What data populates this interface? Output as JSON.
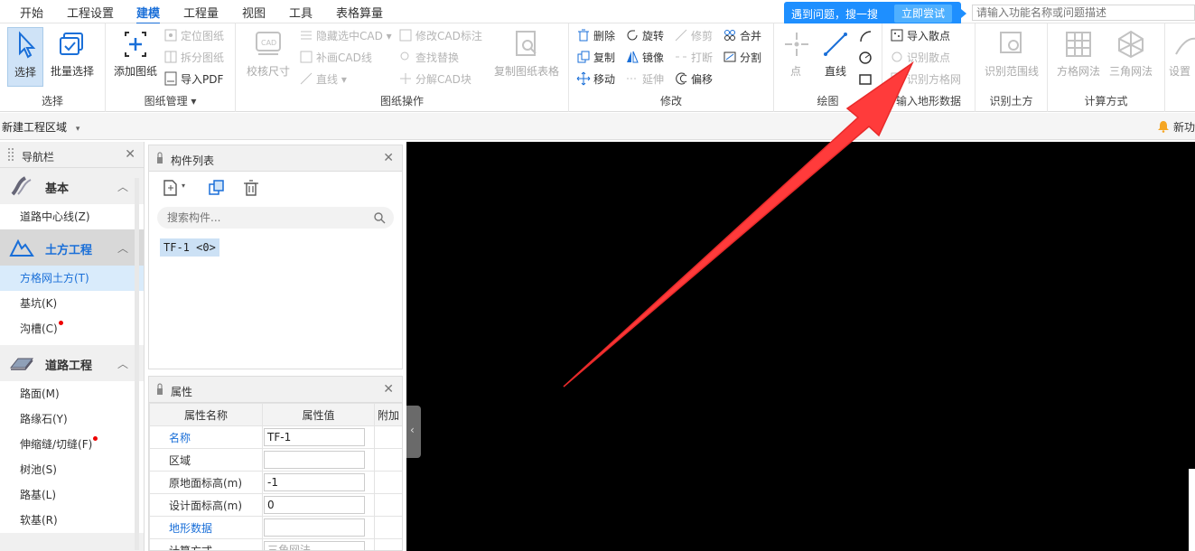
{
  "menu": [
    "开始",
    "工程设置",
    "建模",
    "工程量",
    "视图",
    "工具",
    "表格算量"
  ],
  "active_menu": "建模",
  "help": {
    "text": "遇到问题，搜一搜",
    "button": "立即尝试"
  },
  "func_search_placeholder": "请输入功能名称或问题描述",
  "ribbon": {
    "select": {
      "label": "选择",
      "select": "选择",
      "batch": "批量选择"
    },
    "drawing_mgmt": {
      "label": "图纸管理",
      "add": "添加图纸",
      "locate": "定位图纸",
      "split": "拆分图纸",
      "import_pdf": "导入PDF"
    },
    "drawing_ops": {
      "label": "图纸操作",
      "check_size": "校核尺寸",
      "hide_cad": "隐藏选中CAD",
      "fill_cad": "补画CAD线",
      "line": "直线",
      "mod_mark": "修改CAD标注",
      "find_replace": "查找替换",
      "explode": "分解CAD块",
      "copy_table": "复制图纸表格"
    },
    "modify": {
      "label": "修改",
      "delete": "删除",
      "copy": "复制",
      "move": "移动",
      "rotate": "旋转",
      "mirror": "镜像",
      "extend": "延伸",
      "trim": "修剪",
      "break": "打断",
      "offset": "偏移",
      "merge": "合并",
      "split": "分割"
    },
    "draw": {
      "label": "绘图",
      "point": "点",
      "line": "直线"
    },
    "terrain": {
      "label": "输入地形数据",
      "import_points": "导入散点",
      "identify_points": "识别散点",
      "identify_grid_points": "识别方格网"
    },
    "earthwork": {
      "label": "识别土方",
      "identify_range": "识别范围线"
    },
    "calc": {
      "label": "计算方式",
      "grid": "方格网法",
      "triangle": "三角网法"
    },
    "settings": "设置"
  },
  "area_select": "新建工程区域",
  "new_func": "新功",
  "nav": {
    "title": "导航栏",
    "categories": [
      {
        "label": "基本",
        "items": [
          "道路中心线(Z)"
        ]
      },
      {
        "label": "土方工程",
        "items": [
          "方格网土方(T)",
          "基坑(K)",
          "沟槽(C)"
        ]
      },
      {
        "label": "道路工程",
        "items": [
          "路面(M)",
          "路缘石(Y)",
          "伸缩缝/切缝(F)",
          "树池(S)",
          "路基(L)",
          "软基(R)"
        ]
      }
    ]
  },
  "component_list": {
    "title": "构件列表",
    "search_placeholder": "搜索构件...",
    "items": [
      "TF-1 <0>"
    ]
  },
  "properties": {
    "title": "属性",
    "headers": [
      "属性名称",
      "属性值",
      "附加"
    ],
    "rows": [
      {
        "name": "名称",
        "value": "TF-1"
      },
      {
        "name": "区域",
        "value": ""
      },
      {
        "name": "原地面标高(m)",
        "value": "-1"
      },
      {
        "name": "设计面标高(m)",
        "value": "0"
      },
      {
        "name": "地形数据",
        "value": ""
      },
      {
        "name": "计算方式",
        "value": "三角网法"
      }
    ]
  },
  "colors": {
    "accent": "#1a6fd8",
    "arrow": "#ff3b3b",
    "help": "#1e8fff"
  }
}
